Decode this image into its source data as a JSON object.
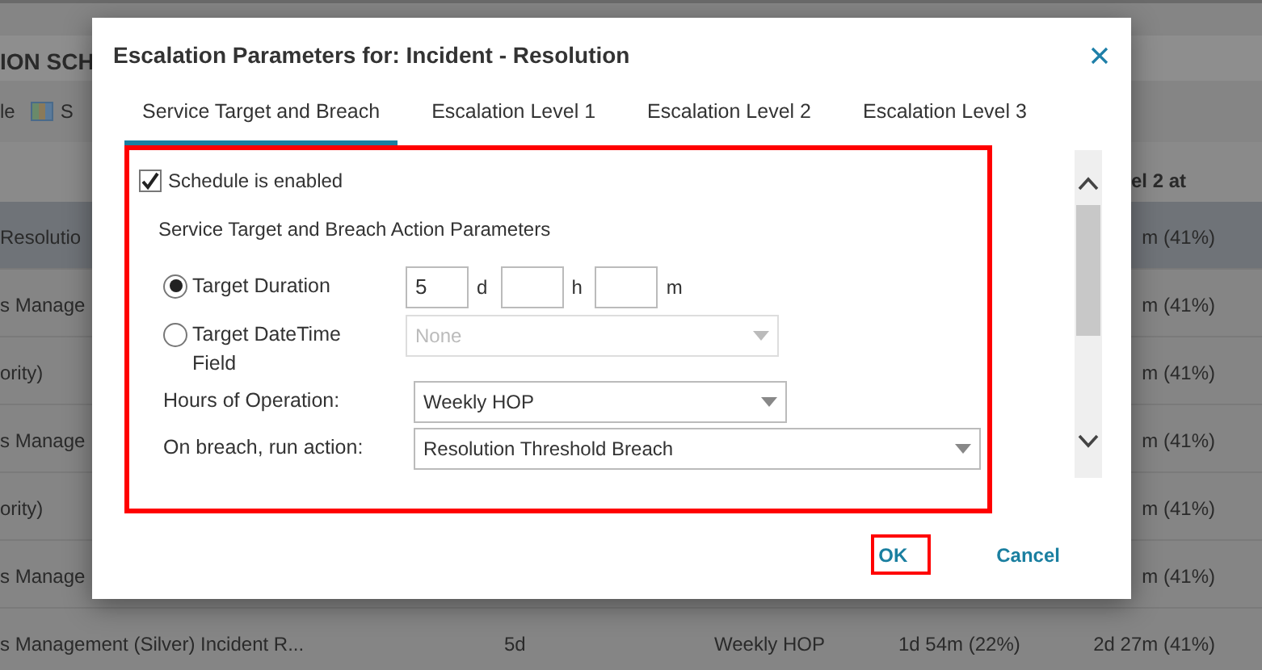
{
  "background": {
    "heading": "ION SCH",
    "toolbar": [
      {
        "label": "le",
        "icon": false
      },
      {
        "label": "S",
        "icon": true
      }
    ],
    "header": "el 2 at",
    "rows": [
      {
        "selected": true,
        "column_1": "Resolutio",
        "column_5": "m (41%)"
      },
      {
        "selected": false,
        "column_1": "s Manage",
        "column_5": "m (41%)"
      },
      {
        "selected": false,
        "column_1": "ority)",
        "column_5": "m (41%)"
      },
      {
        "selected": false,
        "column_1": "s Manage",
        "column_5": "m (41%)"
      },
      {
        "selected": false,
        "column_1": "ority)",
        "column_5": "m (41%)"
      },
      {
        "selected": false,
        "column_1": "s Manage",
        "column_5": "m (41%)"
      },
      {
        "selected": false,
        "column_1": "s Management (Silver) Incident R...",
        "column_2": "5d",
        "column_3": "Weekly HOP",
        "column_4": "1d 54m (22%)",
        "column_5": "2d 27m (41%)"
      }
    ]
  },
  "dialog": {
    "title": "Escalation Parameters for: Incident - Resolution",
    "tabs": [
      {
        "label": "Service Target and Breach",
        "selected": true
      },
      {
        "label": "Escalation Level 1",
        "selected": false
      },
      {
        "label": "Escalation Level 2",
        "selected": false
      },
      {
        "label": "Escalation Level 3",
        "selected": false
      }
    ],
    "content_highlighted": true,
    "schedule": {
      "label": "Schedule is enabled",
      "checked": true
    },
    "section_title": "Service Target and Breach Action Parameters",
    "target_options": [
      {
        "kind": "duration",
        "label": "Target Duration",
        "selected": true,
        "fields": [
          {
            "value": "5",
            "unit": "d"
          },
          {
            "unit": "h"
          },
          {
            "unit": "m"
          }
        ]
      },
      {
        "kind": "dropdown",
        "label": "Target DateTime Field",
        "selected": false,
        "dropdown": {
          "value": "None",
          "disabled": true
        }
      }
    ],
    "settings": [
      {
        "label": "Hours of Operation:",
        "value": "Weekly HOP"
      },
      {
        "label": "On breach, run action:",
        "value": "Resolution Threshold Breach"
      }
    ],
    "buttons": [
      {
        "label": "OK",
        "highlighted": true
      },
      {
        "label": "Cancel",
        "highlighted": false
      }
    ]
  }
}
